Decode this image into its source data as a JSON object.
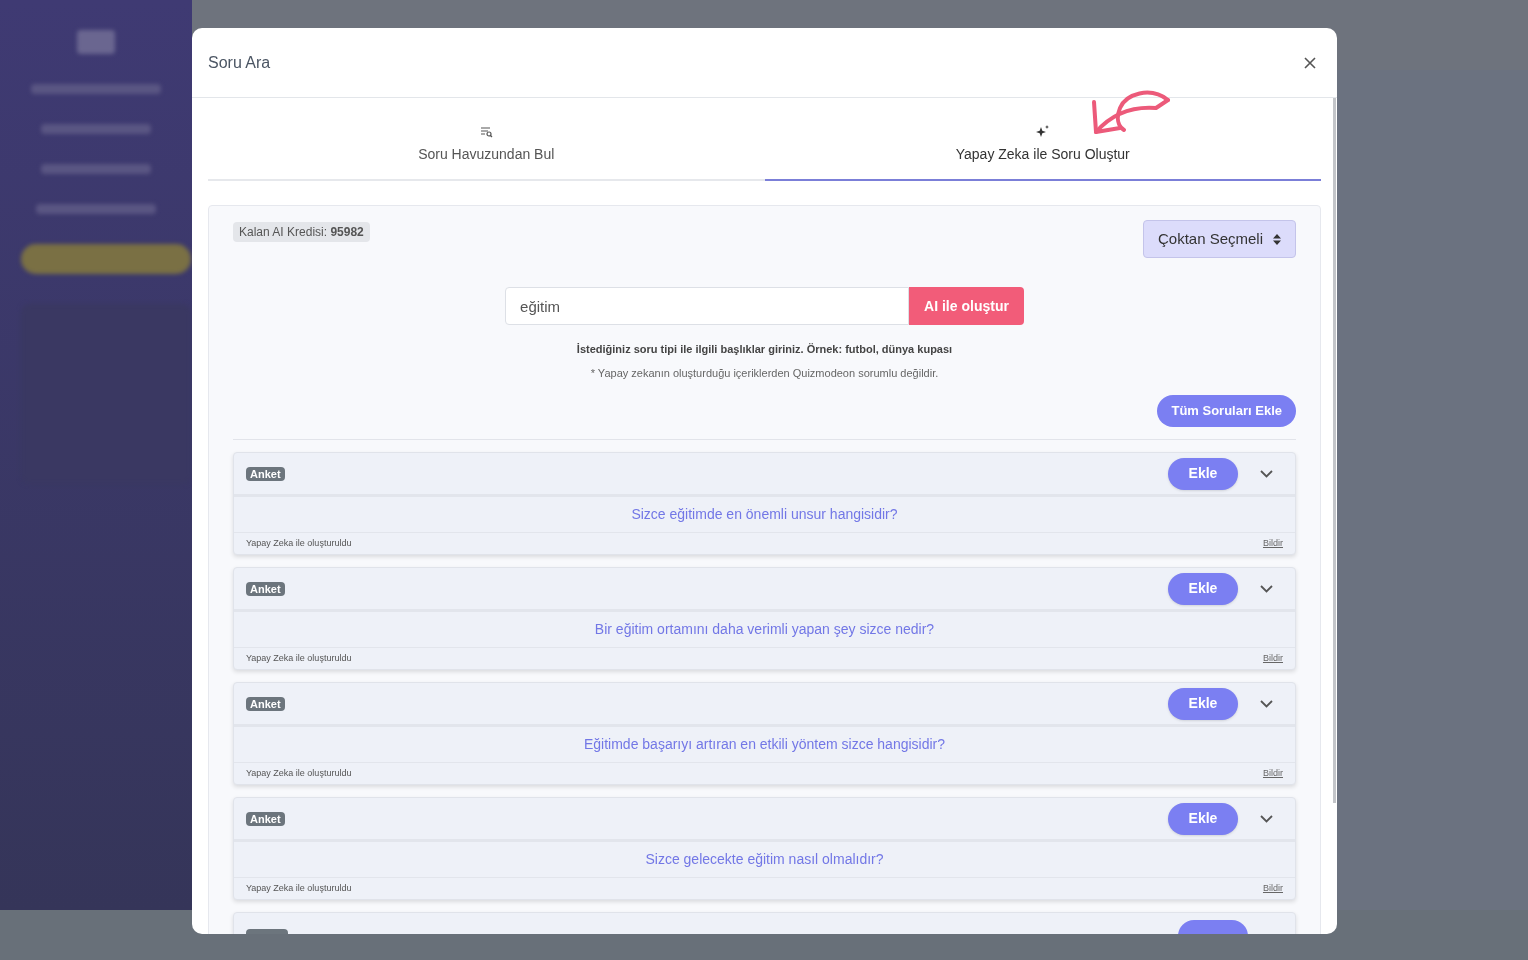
{
  "modal": {
    "title": "Soru Ara"
  },
  "tabs": [
    {
      "label": "Soru Havuzundan Bul",
      "kind": "pool",
      "selected": false
    },
    {
      "label": "Yapay Zeka ile Soru Oluştur",
      "kind": "ai",
      "selected": true
    }
  ],
  "credits": {
    "label": "Kalan AI Kredisi:",
    "value": "95982"
  },
  "type_select": {
    "value": "Çoktan Seçmeli"
  },
  "topic": {
    "value": "eğitim",
    "button": "AI ile oluştur"
  },
  "hint": "İstediğiniz soru tipi ile ilgili başlıklar giriniz. Örnek: futbol, dünya kupası",
  "disclaimer": "* Yapay zekanın oluşturduğu içeriklerden Quizmodeon sorumlu değildir.",
  "add_all_button": "Tüm Soruları Ekle",
  "questions": [
    {
      "badge": "Anket",
      "button": "Ekle",
      "question": "Sizce eğitimde en önemli unsur hangisidir?",
      "source": "Yapay Zeka ile oluşturuldu",
      "report": "Bildir"
    },
    {
      "badge": "Anket",
      "button": "Ekle",
      "question": "Bir eğitim ortamını daha verimli yapan şey sizce nedir?",
      "source": "Yapay Zeka ile oluşturuldu",
      "report": "Bildir"
    },
    {
      "badge": "Anket",
      "button": "Ekle",
      "question": "Eğitimde başarıyı artıran en etkili yöntem sizce hangisidir?",
      "source": "Yapay Zeka ile oluşturuldu",
      "report": "Bildir"
    },
    {
      "badge": "Anket",
      "button": "Ekle",
      "question": "Sizce gelecekte eğitim nasıl olmalıdır?",
      "source": "Yapay Zeka ile oluşturuldu",
      "report": "Bildir"
    },
    {
      "kind": "clipped"
    }
  ]
}
